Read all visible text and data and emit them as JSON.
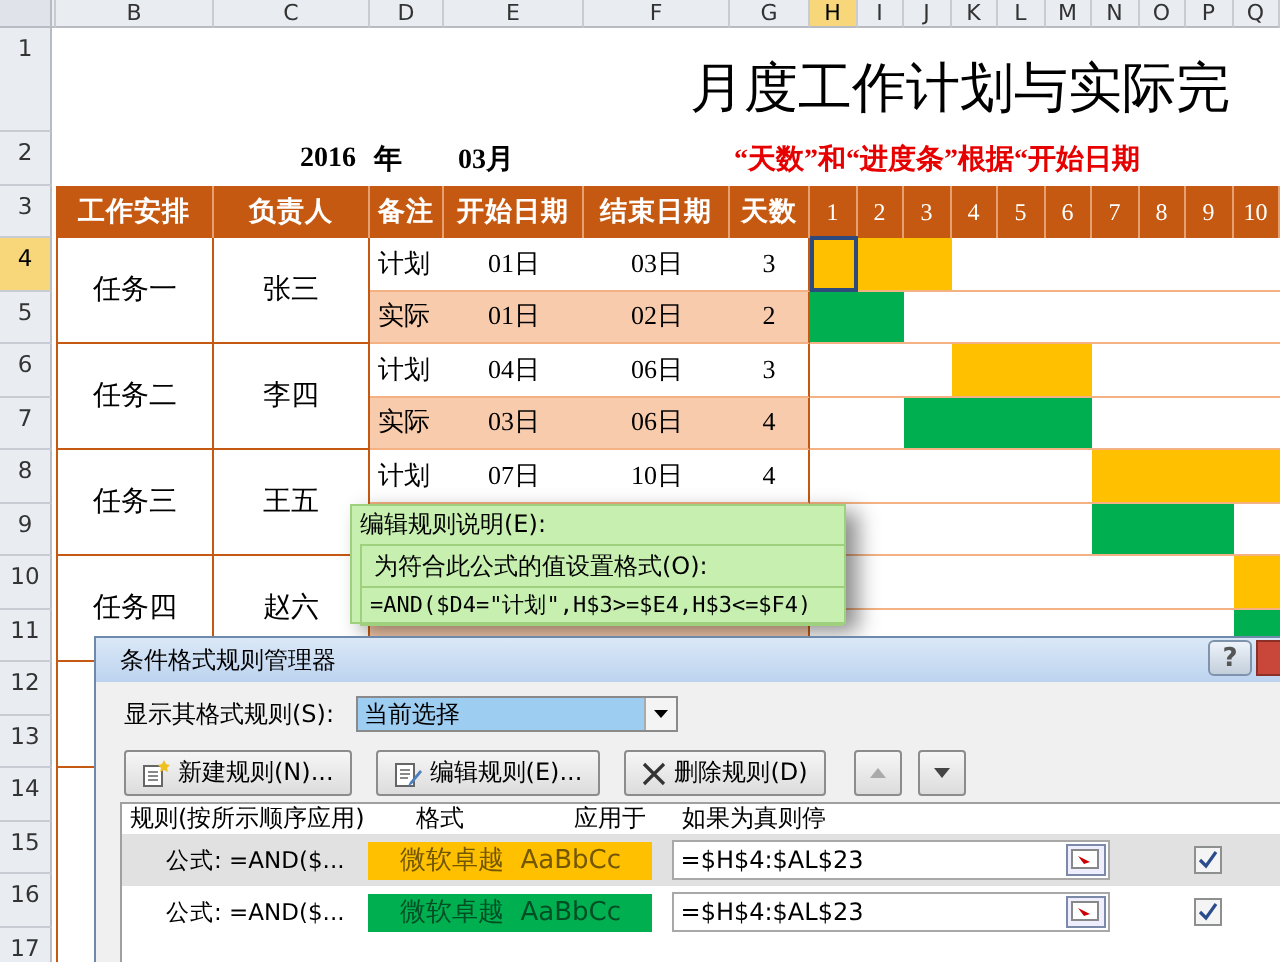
{
  "column_headers": [
    {
      "label": "B",
      "selected": false
    },
    {
      "label": "C",
      "selected": false
    },
    {
      "label": "D",
      "selected": false
    },
    {
      "label": "E",
      "selected": false
    },
    {
      "label": "F",
      "selected": false
    },
    {
      "label": "G",
      "selected": false
    },
    {
      "label": "H",
      "selected": true
    },
    {
      "label": "I",
      "selected": false
    },
    {
      "label": "J",
      "selected": false
    },
    {
      "label": "K",
      "selected": false
    },
    {
      "label": "L",
      "selected": false
    },
    {
      "label": "M",
      "selected": false
    },
    {
      "label": "N",
      "selected": false
    },
    {
      "label": "O",
      "selected": false
    },
    {
      "label": "P",
      "selected": false
    },
    {
      "label": "Q",
      "selected": false
    }
  ],
  "row_headers": [
    {
      "label": "1",
      "selected": false
    },
    {
      "label": "2",
      "selected": false
    },
    {
      "label": "3",
      "selected": false
    },
    {
      "label": "4",
      "selected": true
    },
    {
      "label": "5",
      "selected": false
    },
    {
      "label": "6",
      "selected": false
    },
    {
      "label": "7",
      "selected": false
    },
    {
      "label": "8",
      "selected": false
    },
    {
      "label": "9",
      "selected": false
    },
    {
      "label": "10",
      "selected": false
    },
    {
      "label": "11",
      "selected": false
    },
    {
      "label": "12",
      "selected": false
    },
    {
      "label": "13",
      "selected": false
    },
    {
      "label": "14",
      "selected": false
    },
    {
      "label": "15",
      "selected": false
    },
    {
      "label": "16",
      "selected": false
    },
    {
      "label": "17",
      "selected": false
    }
  ],
  "sheet": {
    "title": "月度工作计划与实际完",
    "year": "2016",
    "year_unit": "年",
    "month": "03月",
    "note": "“天数”和“进度条”根据“开始日期",
    "header": [
      "工作安排",
      "负责人",
      "备注",
      "开始日期",
      "结束日期",
      "天数"
    ],
    "days": [
      "1",
      "2",
      "3",
      "4",
      "5",
      "6",
      "7",
      "8",
      "9",
      "10"
    ],
    "tasks": [
      {
        "name": "任务一",
        "owner": "张三",
        "rows": [
          {
            "kind": "plan",
            "note": "计划",
            "start": "01日",
            "end": "03日",
            "days": "3",
            "bars": [
              {
                "filled": true,
                "color": "#ffc000"
              },
              {
                "filled": true,
                "color": "#ffc000"
              },
              {
                "filled": true,
                "color": "#ffc000"
              },
              {
                "filled": false
              },
              {
                "filled": false
              },
              {
                "filled": false
              },
              {
                "filled": false
              },
              {
                "filled": false
              },
              {
                "filled": false
              },
              {
                "filled": false
              }
            ]
          },
          {
            "kind": "actual",
            "note": "实际",
            "start": "01日",
            "end": "02日",
            "days": "2",
            "bars": [
              {
                "filled": true,
                "color": "#00b050"
              },
              {
                "filled": true,
                "color": "#00b050"
              },
              {
                "filled": false
              },
              {
                "filled": false
              },
              {
                "filled": false
              },
              {
                "filled": false
              },
              {
                "filled": false
              },
              {
                "filled": false
              },
              {
                "filled": false
              },
              {
                "filled": false
              }
            ]
          }
        ]
      },
      {
        "name": "任务二",
        "owner": "李四",
        "rows": [
          {
            "kind": "plan",
            "note": "计划",
            "start": "04日",
            "end": "06日",
            "days": "3",
            "bars": [
              {
                "filled": false
              },
              {
                "filled": false
              },
              {
                "filled": false
              },
              {
                "filled": true,
                "color": "#ffc000"
              },
              {
                "filled": true,
                "color": "#ffc000"
              },
              {
                "filled": true,
                "color": "#ffc000"
              },
              {
                "filled": false
              },
              {
                "filled": false
              },
              {
                "filled": false
              },
              {
                "filled": false
              }
            ]
          },
          {
            "kind": "actual",
            "note": "实际",
            "start": "03日",
            "end": "06日",
            "days": "4",
            "bars": [
              {
                "filled": false
              },
              {
                "filled": false
              },
              {
                "filled": true,
                "color": "#00b050"
              },
              {
                "filled": true,
                "color": "#00b050"
              },
              {
                "filled": true,
                "color": "#00b050"
              },
              {
                "filled": true,
                "color": "#00b050"
              },
              {
                "filled": false
              },
              {
                "filled": false
              },
              {
                "filled": false
              },
              {
                "filled": false
              }
            ]
          }
        ]
      },
      {
        "name": "任务三",
        "owner": "王五",
        "rows": [
          {
            "kind": "plan",
            "note": "计划",
            "start": "07日",
            "end": "10日",
            "days": "4",
            "bars": [
              {
                "filled": false
              },
              {
                "filled": false
              },
              {
                "filled": false
              },
              {
                "filled": false
              },
              {
                "filled": false
              },
              {
                "filled": false
              },
              {
                "filled": true,
                "color": "#ffc000"
              },
              {
                "filled": true,
                "color": "#ffc000"
              },
              {
                "filled": true,
                "color": "#ffc000"
              },
              {
                "filled": true,
                "color": "#ffc000"
              }
            ]
          },
          {
            "bars": [
              {
                "filled": false
              },
              {
                "filled": false
              },
              {
                "filled": false
              },
              {
                "filled": false
              },
              {
                "filled": false
              },
              {
                "filled": false
              },
              {
                "filled": true,
                "color": "#00b050"
              },
              {
                "filled": true,
                "color": "#00b050"
              },
              {
                "filled": true,
                "color": "#00b050"
              },
              {
                "filled": false
              }
            ]
          }
        ]
      },
      {
        "name": "任务四",
        "owner": "赵六",
        "rows": [
          {
            "bars": [
              {
                "filled": false
              },
              {
                "filled": false
              },
              {
                "filled": false
              },
              {
                "filled": false
              },
              {
                "filled": false
              },
              {
                "filled": false
              },
              {
                "filled": false
              },
              {
                "filled": false
              },
              {
                "filled": false
              },
              {
                "filled": true,
                "color": "#ffc000"
              }
            ]
          },
          {
            "bars": [
              {
                "filled": false
              },
              {
                "filled": false
              },
              {
                "filled": false
              },
              {
                "filled": false
              },
              {
                "filled": false
              },
              {
                "filled": false
              },
              {
                "filled": false
              },
              {
                "filled": false
              },
              {
                "filled": false
              },
              {
                "filled": true,
                "color": "#00b050"
              }
            ]
          }
        ]
      }
    ]
  },
  "rule_description": {
    "title": "编辑规则说明(E):",
    "label": "为符合此公式的值设置格式(O):",
    "formula": "=AND($D4=\"计划\",H$3>=$E4,H$3<=$F4)"
  },
  "dialog": {
    "title": "条件格式规则管理器",
    "help": "?",
    "show_label": "显示其格式规则(S):",
    "show_value": "当前选择",
    "buttons": [
      {
        "kind": "new",
        "label": "新建规则(N)..."
      },
      {
        "kind": "edit",
        "label": "编辑规则(E)..."
      },
      {
        "kind": "delete",
        "label": "删除规则(D)"
      }
    ],
    "columns": [
      "规则(按所示顺序应用)",
      "格式",
      "应用于",
      "如果为真则停"
    ],
    "rules": [
      {
        "rule": "公式: =AND($...",
        "preview": "微软卓越  AaBbCc",
        "color": "#ffc000",
        "applies_to": "=$H$4:$AL$23",
        "stop_if_true": true,
        "selected": true
      },
      {
        "rule": "公式: =AND($...",
        "preview": "微软卓越  AaBbCc",
        "color": "#00b050",
        "applies_to": "=$H$4:$AL$23",
        "stop_if_true": true,
        "selected": false
      }
    ]
  }
}
